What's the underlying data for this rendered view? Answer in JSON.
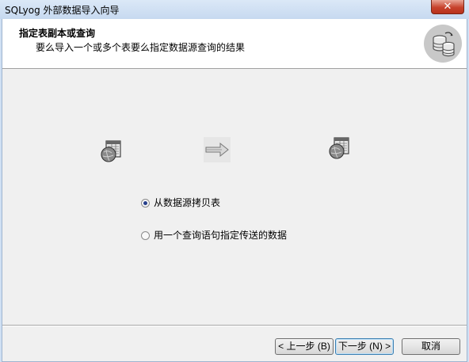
{
  "window": {
    "title": "SQLyog 外部数据导入向导",
    "close_label": "✕"
  },
  "header": {
    "title": "指定表副本或查询",
    "subtitle": "要么导入一个或多个表要么指定数据源查询的结果",
    "icon": "database-icon"
  },
  "diagram": {
    "source_icon": "table-globe-icon",
    "arrow_icon": "arrow-right-icon",
    "target_icon": "table-globe-icon"
  },
  "options": [
    {
      "label": "从数据源拷贝表",
      "checked": true
    },
    {
      "label": "用一个查询语句指定传送的数据",
      "checked": false
    }
  ],
  "buttons": {
    "back": "< 上一步 (B)",
    "next": "下一步 (N) >",
    "cancel": "取消"
  },
  "colors": {
    "title_bar": "#c6d9f0",
    "close_button": "#c7432d",
    "window_bg": "#f0f0f0",
    "header_bg": "#ffffff",
    "radio_dot": "#27408b"
  }
}
